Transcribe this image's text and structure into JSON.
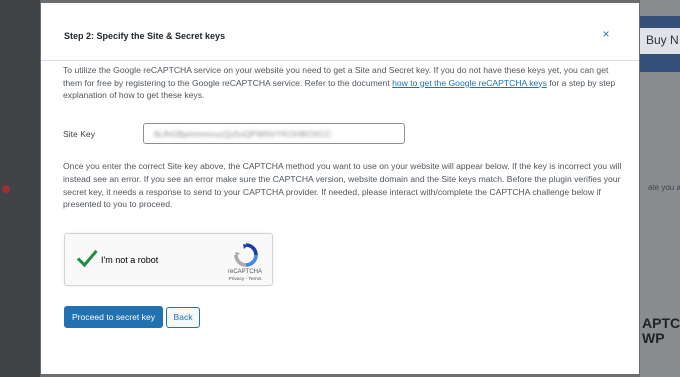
{
  "background": {
    "buy_text": "Buy N",
    "small_text": "ate you a",
    "big_text_line1": "APTCH",
    "big_text_line2": "WP"
  },
  "modal": {
    "title": "Step 2: Specify the Site & Secret keys",
    "close_icon": "×",
    "intro_text_before_link": "To utilize the Google reCAPTCHA service on your website you need to get a Site and Secret key. If you do not have these keys yet, you can get them for free by registering to the Google reCAPTCHA service. Refer to the document ",
    "intro_link": "how to get the Google reCAPTCHA keys",
    "intro_text_after_link": " for a step by step explanation of how to get these keys.",
    "site_key_label": "Site Key",
    "site_key_value": "6LfhGBpmnnnnucQy5oQPWNVYKOHBOXCC",
    "info_text": "Once you enter the correct Site key above, the CAPTCHA method you want to use on your website will appear below. If the key is incorrect you will instead see an error. If you see an error make sure the CAPTCHA version, website domain and the Site keys match. Before the plugin verifies your secret key, it needs a response to send to your CAPTCHA provider. If needed, please interact with/complete the CAPTCHA challenge below if presented to you to proceed."
  },
  "recaptcha": {
    "label": "I'm not a robot",
    "brand": "reCAPTCHA",
    "links": "Privacy - Terms",
    "checked": true
  },
  "buttons": {
    "proceed_label": "Proceed to secret key",
    "back_label": "Back"
  },
  "colors": {
    "accent": "#2271b1",
    "check": "#1e8e3e"
  }
}
